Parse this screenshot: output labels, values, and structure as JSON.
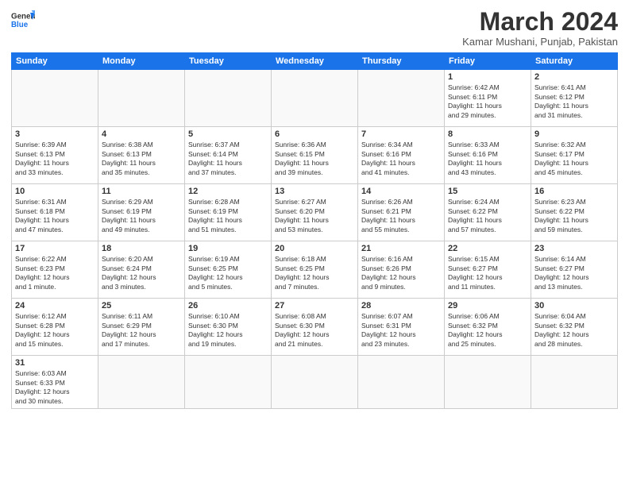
{
  "header": {
    "logo_general": "General",
    "logo_blue": "Blue",
    "month": "March 2024",
    "location": "Kamar Mushani, Punjab, Pakistan"
  },
  "days_of_week": [
    "Sunday",
    "Monday",
    "Tuesday",
    "Wednesday",
    "Thursday",
    "Friday",
    "Saturday"
  ],
  "weeks": [
    [
      {
        "day": "",
        "info": ""
      },
      {
        "day": "",
        "info": ""
      },
      {
        "day": "",
        "info": ""
      },
      {
        "day": "",
        "info": ""
      },
      {
        "day": "",
        "info": ""
      },
      {
        "day": "1",
        "info": "Sunrise: 6:42 AM\nSunset: 6:11 PM\nDaylight: 11 hours\nand 29 minutes."
      },
      {
        "day": "2",
        "info": "Sunrise: 6:41 AM\nSunset: 6:12 PM\nDaylight: 11 hours\nand 31 minutes."
      }
    ],
    [
      {
        "day": "3",
        "info": "Sunrise: 6:39 AM\nSunset: 6:13 PM\nDaylight: 11 hours\nand 33 minutes."
      },
      {
        "day": "4",
        "info": "Sunrise: 6:38 AM\nSunset: 6:13 PM\nDaylight: 11 hours\nand 35 minutes."
      },
      {
        "day": "5",
        "info": "Sunrise: 6:37 AM\nSunset: 6:14 PM\nDaylight: 11 hours\nand 37 minutes."
      },
      {
        "day": "6",
        "info": "Sunrise: 6:36 AM\nSunset: 6:15 PM\nDaylight: 11 hours\nand 39 minutes."
      },
      {
        "day": "7",
        "info": "Sunrise: 6:34 AM\nSunset: 6:16 PM\nDaylight: 11 hours\nand 41 minutes."
      },
      {
        "day": "8",
        "info": "Sunrise: 6:33 AM\nSunset: 6:16 PM\nDaylight: 11 hours\nand 43 minutes."
      },
      {
        "day": "9",
        "info": "Sunrise: 6:32 AM\nSunset: 6:17 PM\nDaylight: 11 hours\nand 45 minutes."
      }
    ],
    [
      {
        "day": "10",
        "info": "Sunrise: 6:31 AM\nSunset: 6:18 PM\nDaylight: 11 hours\nand 47 minutes."
      },
      {
        "day": "11",
        "info": "Sunrise: 6:29 AM\nSunset: 6:19 PM\nDaylight: 11 hours\nand 49 minutes."
      },
      {
        "day": "12",
        "info": "Sunrise: 6:28 AM\nSunset: 6:19 PM\nDaylight: 11 hours\nand 51 minutes."
      },
      {
        "day": "13",
        "info": "Sunrise: 6:27 AM\nSunset: 6:20 PM\nDaylight: 11 hours\nand 53 minutes."
      },
      {
        "day": "14",
        "info": "Sunrise: 6:26 AM\nSunset: 6:21 PM\nDaylight: 11 hours\nand 55 minutes."
      },
      {
        "day": "15",
        "info": "Sunrise: 6:24 AM\nSunset: 6:22 PM\nDaylight: 11 hours\nand 57 minutes."
      },
      {
        "day": "16",
        "info": "Sunrise: 6:23 AM\nSunset: 6:22 PM\nDaylight: 11 hours\nand 59 minutes."
      }
    ],
    [
      {
        "day": "17",
        "info": "Sunrise: 6:22 AM\nSunset: 6:23 PM\nDaylight: 12 hours\nand 1 minute."
      },
      {
        "day": "18",
        "info": "Sunrise: 6:20 AM\nSunset: 6:24 PM\nDaylight: 12 hours\nand 3 minutes."
      },
      {
        "day": "19",
        "info": "Sunrise: 6:19 AM\nSunset: 6:25 PM\nDaylight: 12 hours\nand 5 minutes."
      },
      {
        "day": "20",
        "info": "Sunrise: 6:18 AM\nSunset: 6:25 PM\nDaylight: 12 hours\nand 7 minutes."
      },
      {
        "day": "21",
        "info": "Sunrise: 6:16 AM\nSunset: 6:26 PM\nDaylight: 12 hours\nand 9 minutes."
      },
      {
        "day": "22",
        "info": "Sunrise: 6:15 AM\nSunset: 6:27 PM\nDaylight: 12 hours\nand 11 minutes."
      },
      {
        "day": "23",
        "info": "Sunrise: 6:14 AM\nSunset: 6:27 PM\nDaylight: 12 hours\nand 13 minutes."
      }
    ],
    [
      {
        "day": "24",
        "info": "Sunrise: 6:12 AM\nSunset: 6:28 PM\nDaylight: 12 hours\nand 15 minutes."
      },
      {
        "day": "25",
        "info": "Sunrise: 6:11 AM\nSunset: 6:29 PM\nDaylight: 12 hours\nand 17 minutes."
      },
      {
        "day": "26",
        "info": "Sunrise: 6:10 AM\nSunset: 6:30 PM\nDaylight: 12 hours\nand 19 minutes."
      },
      {
        "day": "27",
        "info": "Sunrise: 6:08 AM\nSunset: 6:30 PM\nDaylight: 12 hours\nand 21 minutes."
      },
      {
        "day": "28",
        "info": "Sunrise: 6:07 AM\nSunset: 6:31 PM\nDaylight: 12 hours\nand 23 minutes."
      },
      {
        "day": "29",
        "info": "Sunrise: 6:06 AM\nSunset: 6:32 PM\nDaylight: 12 hours\nand 25 minutes."
      },
      {
        "day": "30",
        "info": "Sunrise: 6:04 AM\nSunset: 6:32 PM\nDaylight: 12 hours\nand 28 minutes."
      }
    ],
    [
      {
        "day": "31",
        "info": "Sunrise: 6:03 AM\nSunset: 6:33 PM\nDaylight: 12 hours\nand 30 minutes."
      },
      {
        "day": "",
        "info": ""
      },
      {
        "day": "",
        "info": ""
      },
      {
        "day": "",
        "info": ""
      },
      {
        "day": "",
        "info": ""
      },
      {
        "day": "",
        "info": ""
      },
      {
        "day": "",
        "info": ""
      }
    ]
  ]
}
